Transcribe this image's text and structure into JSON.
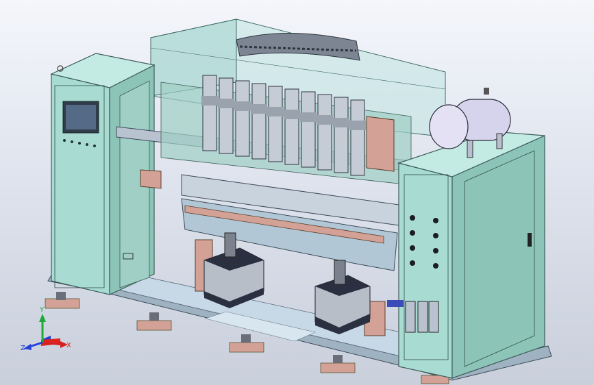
{
  "viewport": {
    "background_top": "#f4f6fb",
    "background_bottom": "#c9cfdb"
  },
  "colors": {
    "cabinet_face": "#a8dcd2",
    "cabinet_side": "#8cc4b8",
    "cabinet_edge": "#3d5c58",
    "glass": "#bfe4e0",
    "frame_steel": "#b9c3cf",
    "bracket_copper": "#d4a196",
    "cylinder_body": "#b8bec8",
    "cylinder_cap": "#2a3040",
    "tank": "#d6d3ec",
    "base_plate": "#c7d8e6",
    "screen": "#556a86"
  },
  "triad": {
    "x_label": "X",
    "y_label": "Y",
    "z_label": "Z",
    "x_color": "#d62020",
    "y_color": "#1fa83a",
    "z_color": "#2440d8"
  }
}
